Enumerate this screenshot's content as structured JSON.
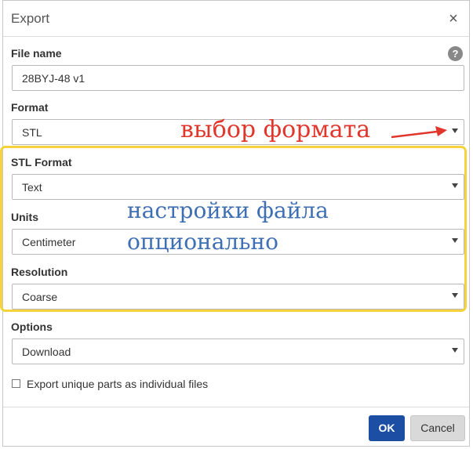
{
  "dialog": {
    "title": "Export",
    "close_icon": "×",
    "help_icon": "?"
  },
  "fields": {
    "file_name": {
      "label": "File name",
      "value": "28BYJ-48 v1"
    },
    "format": {
      "label": "Format",
      "value": "STL"
    },
    "stl_format": {
      "label": "STL Format",
      "value": "Text"
    },
    "units": {
      "label": "Units",
      "value": "Centimeter"
    },
    "resolution": {
      "label": "Resolution",
      "value": "Coarse"
    },
    "options": {
      "label": "Options",
      "value": "Download"
    }
  },
  "checkbox": {
    "label": "Export unique parts as individual files",
    "checked": false
  },
  "buttons": {
    "ok": "OK",
    "cancel": "Cancel"
  },
  "annotations": {
    "format_hint": "выбор формата",
    "settings_line1": "настройки файла",
    "settings_line2": "опционально"
  },
  "colors": {
    "primary_button": "#1c4ea4",
    "highlight_frame": "#f6d33c",
    "annotation_red": "#e0362c",
    "annotation_blue": "#3f6fb3"
  }
}
